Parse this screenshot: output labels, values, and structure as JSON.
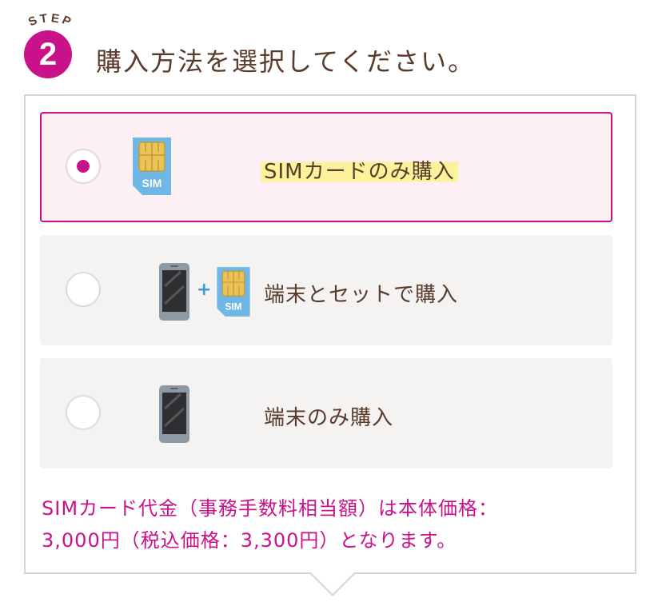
{
  "header": {
    "step_word": "STEP",
    "step_number": "2",
    "title": "購入方法を選択してください。"
  },
  "options": [
    {
      "label": "SIMカードのみ購入",
      "selected": true,
      "icons": [
        "sim-card-icon"
      ]
    },
    {
      "label": "端末とセットで購入",
      "selected": false,
      "icons": [
        "smartphone-icon",
        "plus-icon",
        "sim-card-icon"
      ]
    },
    {
      "label": "端末のみ購入",
      "selected": false,
      "icons": [
        "smartphone-icon"
      ]
    }
  ],
  "icons": {
    "sim_label": "SIM",
    "plus": "+"
  },
  "note": {
    "line1": "SIMカード代金（事務手数料相当額）は本体価格：",
    "line2": "3,000円（税込価格：3,300円）となります。"
  },
  "colors": {
    "accent": "#c9128a",
    "text": "#5a3a2a",
    "highlight": "#fbf39b",
    "sim_blue": "#6fb7e6",
    "chip_gold": "#e9c35a"
  }
}
